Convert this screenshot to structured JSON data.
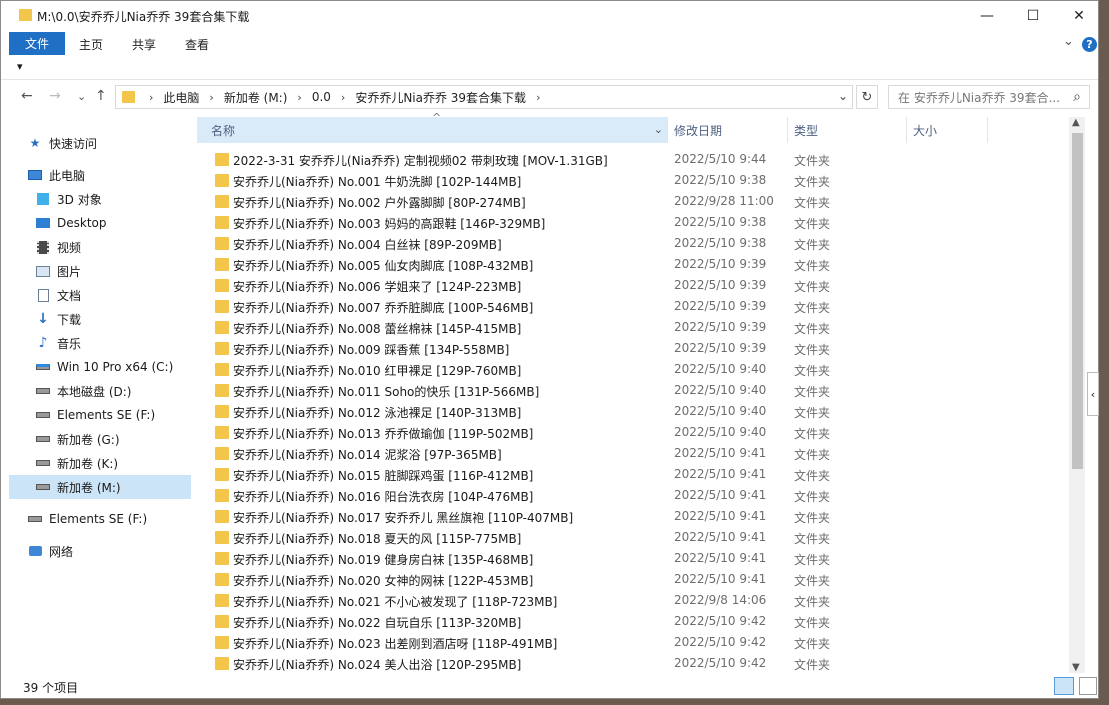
{
  "window": {
    "title": "M:\\0.0\\安乔乔儿Nia乔乔 39套合集下载",
    "minimize_glyph": "—",
    "maximize_glyph": "☐",
    "close_glyph": "✕"
  },
  "ribbon": {
    "tabs": [
      "文件",
      "主页",
      "共享",
      "查看"
    ],
    "help_glyph": "?",
    "expand_glyph": "⌄"
  },
  "quick_access_glyph": "▾",
  "address": {
    "crumbs": [
      "此电脑",
      "新加卷 (M:)",
      "0.0",
      "安乔乔儿Nia乔乔 39套合集下载"
    ],
    "separator": "›",
    "dropdown_glyph": "⌄",
    "refresh_glyph": "↻"
  },
  "search": {
    "placeholder": "在 安乔乔儿Nia乔乔 39套合...",
    "icon_glyph": "⌕"
  },
  "nav_glyphs": {
    "back": "←",
    "forward": "→",
    "recent": "⌄",
    "up": "↑"
  },
  "nav_pane": {
    "quick_access": "快速访问",
    "this_pc": "此电脑",
    "items": [
      "3D 对象",
      "Desktop",
      "视频",
      "图片",
      "文档",
      "下载",
      "音乐",
      "Win 10 Pro x64 (C:)",
      "本地磁盘 (D:)",
      "Elements SE (F:)",
      "新加卷 (G:)",
      "新加卷 (K:)",
      "新加卷 (M:)"
    ],
    "selected_item": "新加卷 (M:)",
    "elements_drive": "Elements SE (F:)",
    "network": "网络"
  },
  "columns": {
    "name": "名称",
    "date": "修改日期",
    "type": "类型",
    "size": "大小",
    "sort_glyph": "^",
    "filter_glyph": "⌄"
  },
  "files": [
    {
      "name": "2022-3-31 安乔乔儿(Nia乔乔) 定制视频02 带刺玫瑰 [MOV-1.31GB]",
      "date": "2022/5/10 9:44",
      "type": "文件夹"
    },
    {
      "name": "安乔乔儿(Nia乔乔) No.001 牛奶洗脚 [102P-144MB]",
      "date": "2022/5/10 9:38",
      "type": "文件夹"
    },
    {
      "name": "安乔乔儿(Nia乔乔) No.002 户外露脚脚 [80P-274MB]",
      "date": "2022/9/28 11:00",
      "type": "文件夹"
    },
    {
      "name": "安乔乔儿(Nia乔乔) No.003 妈妈的高跟鞋 [146P-329MB]",
      "date": "2022/5/10 9:38",
      "type": "文件夹"
    },
    {
      "name": "安乔乔儿(Nia乔乔) No.004 白丝袜 [89P-209MB]",
      "date": "2022/5/10 9:38",
      "type": "文件夹"
    },
    {
      "name": "安乔乔儿(Nia乔乔) No.005 仙女肉脚底 [108P-432MB]",
      "date": "2022/5/10 9:39",
      "type": "文件夹"
    },
    {
      "name": "安乔乔儿(Nia乔乔) No.006 学姐来了 [124P-223MB]",
      "date": "2022/5/10 9:39",
      "type": "文件夹"
    },
    {
      "name": "安乔乔儿(Nia乔乔) No.007 乔乔脏脚底 [100P-546MB]",
      "date": "2022/5/10 9:39",
      "type": "文件夹"
    },
    {
      "name": "安乔乔儿(Nia乔乔) No.008 蕾丝棉袜 [145P-415MB]",
      "date": "2022/5/10 9:39",
      "type": "文件夹"
    },
    {
      "name": "安乔乔儿(Nia乔乔) No.009 踩香蕉 [134P-558MB]",
      "date": "2022/5/10 9:39",
      "type": "文件夹"
    },
    {
      "name": "安乔乔儿(Nia乔乔) No.010 红甲裸足 [129P-760MB]",
      "date": "2022/5/10 9:40",
      "type": "文件夹"
    },
    {
      "name": "安乔乔儿(Nia乔乔) No.011 Soho的快乐 [131P-566MB]",
      "date": "2022/5/10 9:40",
      "type": "文件夹"
    },
    {
      "name": "安乔乔儿(Nia乔乔) No.012 泳池裸足 [140P-313MB]",
      "date": "2022/5/10 9:40",
      "type": "文件夹"
    },
    {
      "name": "安乔乔儿(Nia乔乔) No.013 乔乔做瑜伽 [119P-502MB]",
      "date": "2022/5/10 9:40",
      "type": "文件夹"
    },
    {
      "name": "安乔乔儿(Nia乔乔) No.014 泥浆浴 [97P-365MB]",
      "date": "2022/5/10 9:41",
      "type": "文件夹"
    },
    {
      "name": "安乔乔儿(Nia乔乔) No.015 脏脚踩鸡蛋 [116P-412MB]",
      "date": "2022/5/10 9:41",
      "type": "文件夹"
    },
    {
      "name": "安乔乔儿(Nia乔乔) No.016 阳台洗衣房 [104P-476MB]",
      "date": "2022/5/10 9:41",
      "type": "文件夹"
    },
    {
      "name": "安乔乔儿(Nia乔乔) No.017 安乔乔儿 黑丝旗袍 [110P-407MB]",
      "date": "2022/5/10 9:41",
      "type": "文件夹"
    },
    {
      "name": "安乔乔儿(Nia乔乔) No.018 夏天的风 [115P-775MB]",
      "date": "2022/5/10 9:41",
      "type": "文件夹"
    },
    {
      "name": "安乔乔儿(Nia乔乔) No.019 健身房白袜 [135P-468MB]",
      "date": "2022/5/10 9:41",
      "type": "文件夹"
    },
    {
      "name": "安乔乔儿(Nia乔乔) No.020 女神的网袜 [122P-453MB]",
      "date": "2022/5/10 9:41",
      "type": "文件夹"
    },
    {
      "name": "安乔乔儿(Nia乔乔) No.021 不小心被发现了 [118P-723MB]",
      "date": "2022/9/8 14:06",
      "type": "文件夹"
    },
    {
      "name": "安乔乔儿(Nia乔乔) No.022 自玩自乐 [113P-320MB]",
      "date": "2022/5/10 9:42",
      "type": "文件夹"
    },
    {
      "name": "安乔乔儿(Nia乔乔) No.023 出差刚到酒店呀 [118P-491MB]",
      "date": "2022/5/10 9:42",
      "type": "文件夹"
    },
    {
      "name": "安乔乔儿(Nia乔乔) No.024 美人出浴 [120P-295MB]",
      "date": "2022/5/10 9:42",
      "type": "文件夹"
    }
  ],
  "status": {
    "item_count": "39 个项目"
  },
  "colors": {
    "accent": "#1f6fc4",
    "selection": "#cce4f7",
    "folder": "#f3c54a"
  }
}
